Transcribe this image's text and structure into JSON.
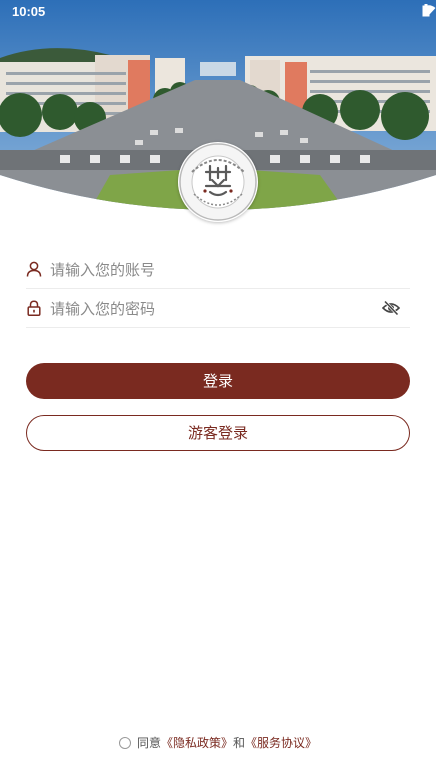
{
  "status_bar": {
    "time": "10:05",
    "icons": [
      "wifi-icon",
      "battery-icon"
    ]
  },
  "hero": {
    "image": "campus-photo",
    "logo": "university-seal-logo"
  },
  "login": {
    "account_placeholder": "请输入您的账号",
    "password_placeholder": "请输入您的密码",
    "login_button": "登录",
    "guest_button": "游客登录"
  },
  "agreement": {
    "prefix": "同意",
    "privacy_link": "《隐私政策》",
    "conjunction": "和",
    "service_link": "《服务协议》"
  },
  "colors": {
    "primary": "#7a2a20",
    "divider": "#ececec",
    "placeholder": "#8a8a8a"
  }
}
